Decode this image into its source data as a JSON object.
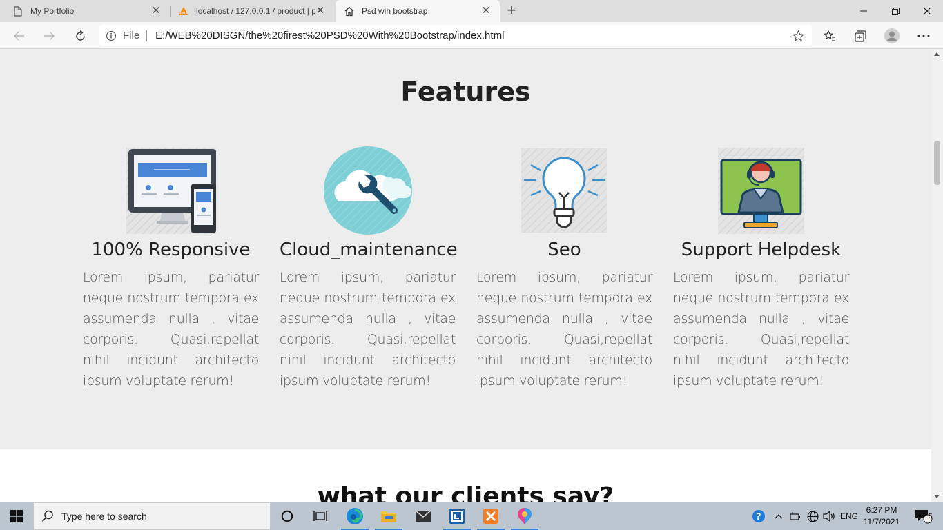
{
  "browser": {
    "tabs": [
      {
        "title": "My Portfolio",
        "favicon": "document-icon",
        "active": false
      },
      {
        "title": "localhost / 127.0.0.1 / product | p",
        "favicon": "phpmyadmin-icon",
        "active": false
      },
      {
        "title": "Psd wih bootstrap",
        "favicon": "home-icon",
        "active": true
      }
    ],
    "scheme_label": "File",
    "url": "E:/WEB%20DISGN/the%20firest%20PSD%20With%20Bootstrap/index.html"
  },
  "page": {
    "features_title": "Features",
    "features": [
      {
        "name": "100% Responsive",
        "icon": "responsive-devices-icon",
        "description": "Lorem ipsum, pariatur neque nostrum tempora ex assumenda nulla , vitae corporis. Quasi,repellat nihil incidunt architecto ipsum voluptate rerum!"
      },
      {
        "name": "Cloud_maintenance",
        "icon": "cloud-wrench-icon",
        "description": "Lorem ipsum, pariatur neque nostrum tempora ex assumenda nulla , vitae corporis. Quasi,repellat nihil incidunt architecto ipsum voluptate rerum!"
      },
      {
        "name": "Seo",
        "icon": "lightbulb-icon",
        "description": "Lorem ipsum, pariatur neque nostrum tempora ex assumenda nulla , vitae corporis. Quasi,repellat nihil incidunt architecto ipsum voluptate rerum!"
      },
      {
        "name": "Support Helpdesk",
        "icon": "helpdesk-agent-icon",
        "description": "Lorem ipsum, pariatur neque nostrum tempora ex assumenda nulla , vitae corporis. Quasi,repellat nihil incidunt architecto ipsum voluptate rerum!"
      }
    ],
    "clients_title": "what our clients say?"
  },
  "taskbar": {
    "search_placeholder": "Type here to search",
    "language": "ENG",
    "time": "6:27 PM",
    "date": "11/7/2021",
    "notification_count": "5"
  },
  "colors": {
    "features_bg": "#ededed",
    "taskbar_bg": "#bcc6d1",
    "tabstrip_bg": "#dedede"
  }
}
